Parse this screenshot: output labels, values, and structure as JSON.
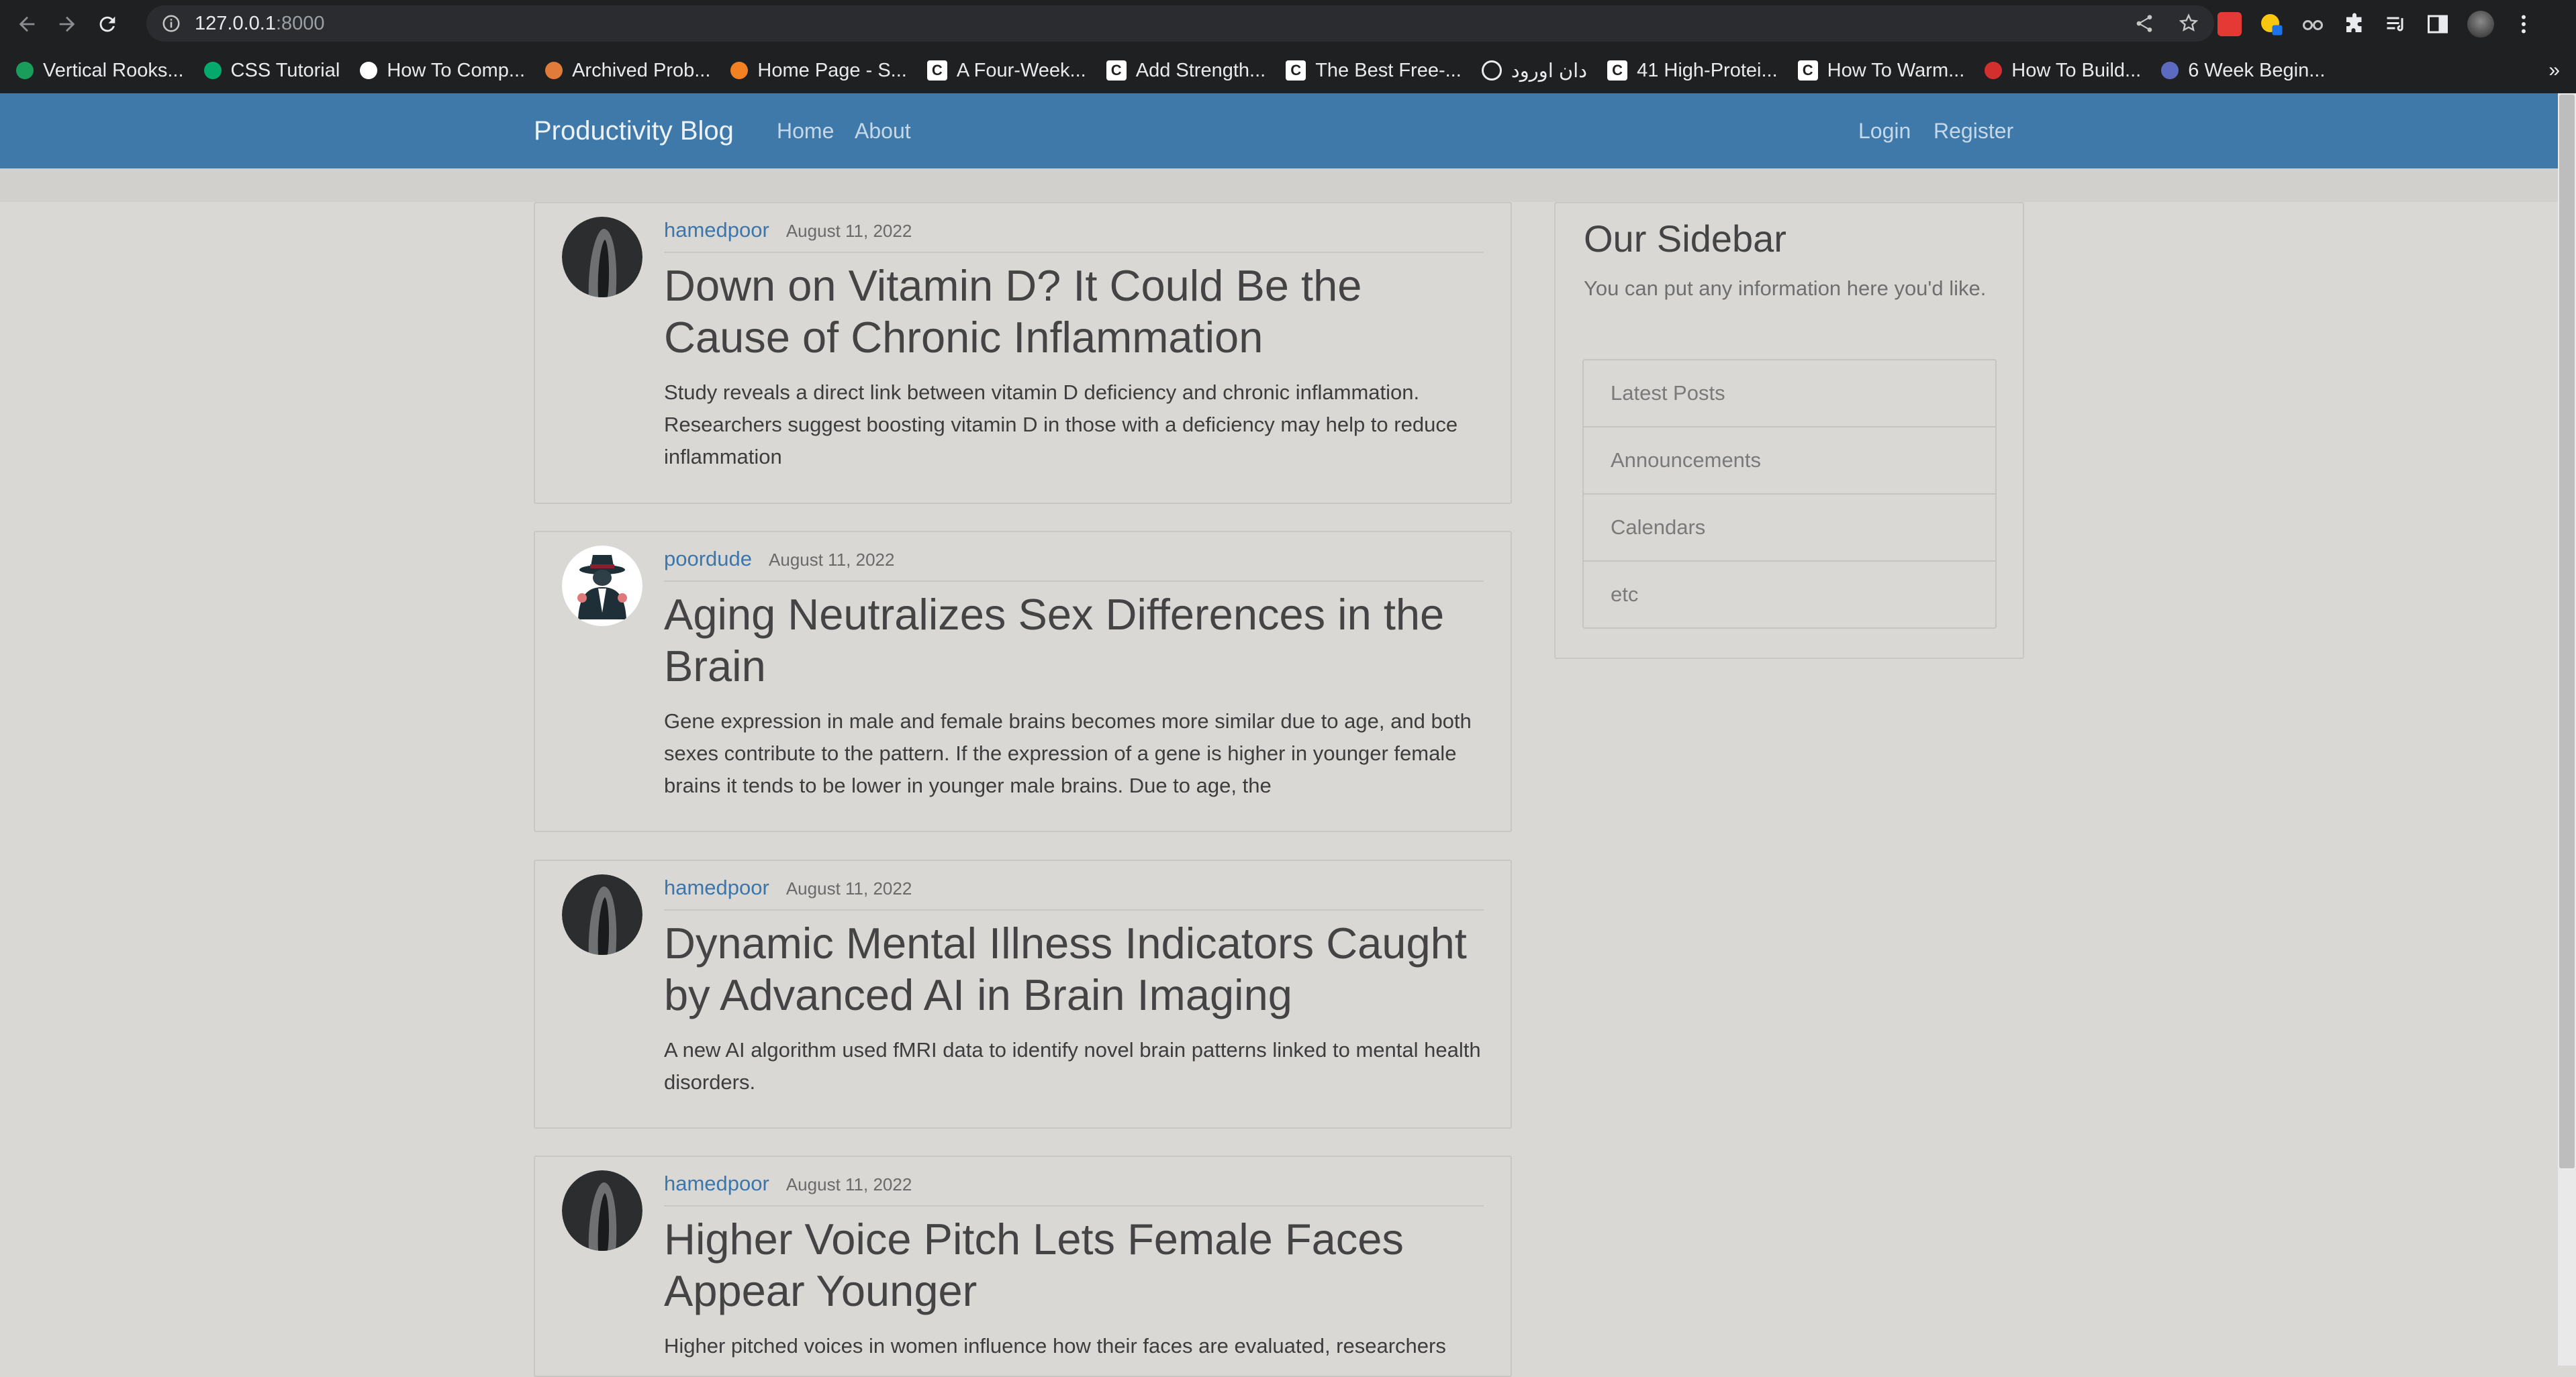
{
  "browser": {
    "url_host": "127.0.0.1",
    "url_port": ":8000",
    "bookmarks": [
      {
        "label": "Vertical Rooks...",
        "icon": "green-bars-favicon",
        "color": "#1a9d5a"
      },
      {
        "label": "CSS Tutorial",
        "icon": "w3schools-favicon",
        "color": "#04aa6d"
      },
      {
        "label": "How To Comp...",
        "icon": "medium-favicon",
        "color": "#ffffff"
      },
      {
        "label": "Archived Prob...",
        "icon": "projecteuler-favicon",
        "color": "#e07b39"
      },
      {
        "label": "Home Page - S...",
        "icon": "stackoverflow-favicon",
        "color": "#f48024"
      },
      {
        "label": "A Four-Week...",
        "icon": "c-favicon",
        "color": "#ffffff"
      },
      {
        "label": "Add Strength...",
        "icon": "c-favicon",
        "color": "#ffffff"
      },
      {
        "label": "The Best Free-...",
        "icon": "c-favicon",
        "color": "#ffffff"
      },
      {
        "label": "دان اورود",
        "icon": "globe-favicon",
        "color": "#ffffff"
      },
      {
        "label": "41 High-Protei...",
        "icon": "c-favicon",
        "color": "#ffffff"
      },
      {
        "label": "How To Warm...",
        "icon": "c-favicon",
        "color": "#ffffff"
      },
      {
        "label": "How To Build...",
        "icon": "red-logo-favicon",
        "color": "#d32f2f"
      },
      {
        "label": "6 Week Begin...",
        "icon": "runner-favicon",
        "color": "#5c6bc0"
      }
    ],
    "more_bookmarks": "»"
  },
  "site": {
    "brand": "Productivity Blog",
    "nav_left": [
      "Home",
      "About"
    ],
    "nav_right": [
      "Login",
      "Register"
    ]
  },
  "posts": [
    {
      "author": "hamedpoor",
      "date": "August 11, 2022",
      "title": "Down on Vitamin D? It Could Be the Cause of Chronic Inflammation",
      "excerpt": "Study reveals a direct link between vitamin D deficiency and chronic inflammation. Researchers suggest boosting vitamin D in those with a deficiency may help to reduce inflammation"
    },
    {
      "author": "poordude",
      "date": "August 11, 2022",
      "title": "Aging Neutralizes Sex Differences in the Brain",
      "excerpt": "Gene expression in male and female brains becomes more similar due to age, and both sexes contribute to the pattern. If the expression of a gene is higher in younger female brains it tends to be lower in younger male brains. Due to age, the"
    },
    {
      "author": "hamedpoor",
      "date": "August 11, 2022",
      "title": "Dynamic Mental Illness Indicators Caught by Advanced AI in Brain Imaging",
      "excerpt": "A new AI algorithm used fMRI data to identify novel brain patterns linked to mental health disorders."
    },
    {
      "author": "hamedpoor",
      "date": "August 11, 2022",
      "title": "Higher Voice Pitch Lets Female Faces Appear Younger",
      "excerpt": "Higher pitched voices in women influence how their faces are evaluated, researchers"
    }
  ],
  "sidebar": {
    "title": "Our Sidebar",
    "description": "You can put any information here you'd like.",
    "items": [
      "Latest Posts",
      "Announcements",
      "Calendars",
      "etc"
    ]
  }
}
